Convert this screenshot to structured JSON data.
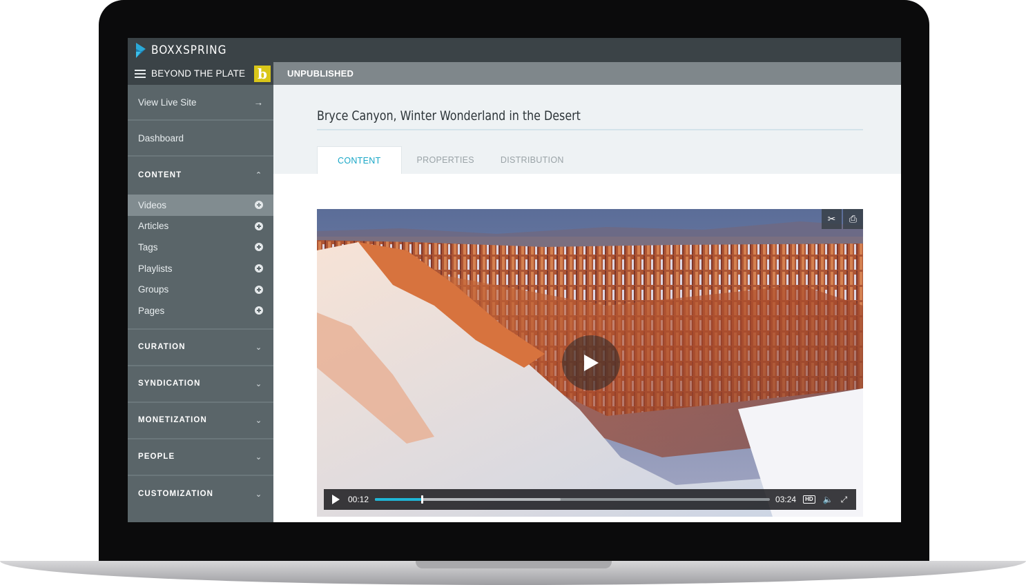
{
  "brand": {
    "name": "BOXXSPRING",
    "icon": "boxxspring-logo-icon",
    "logo_color": "#2aa9d8"
  },
  "site": {
    "name": "BEYOND THE PLATE",
    "badge_letter": "b",
    "badge_color": "#d9c619",
    "menu_icon": "hamburger-icon"
  },
  "nav": {
    "view_live_site": "View Live Site",
    "view_live_icon": "arrow-right-icon",
    "dashboard": "Dashboard"
  },
  "sidebar": {
    "content_section": {
      "label": "CONTENT",
      "expanded": true,
      "items": [
        {
          "label": "Videos",
          "active": true,
          "icon": "plus-circle-icon"
        },
        {
          "label": "Articles",
          "active": false,
          "icon": "plus-circle-icon"
        },
        {
          "label": "Tags",
          "active": false,
          "icon": "plus-circle-icon"
        },
        {
          "label": "Playlists",
          "active": false,
          "icon": "plus-circle-icon"
        },
        {
          "label": "Groups",
          "active": false,
          "icon": "plus-circle-icon"
        },
        {
          "label": "Pages",
          "active": false,
          "icon": "plus-circle-icon"
        }
      ]
    },
    "sections": [
      {
        "label": "CURATION",
        "expanded": false
      },
      {
        "label": "SYNDICATION",
        "expanded": false
      },
      {
        "label": "MONETIZATION",
        "expanded": false
      },
      {
        "label": "PEOPLE",
        "expanded": false
      },
      {
        "label": "CUSTOMIZATION",
        "expanded": false
      }
    ]
  },
  "main": {
    "status": "UNPUBLISHED",
    "title": "Bryce Canyon, Winter Wonderland in the Desert",
    "tabs": [
      {
        "label": "CONTENT",
        "active": true
      },
      {
        "label": "PROPERTIES",
        "active": false
      },
      {
        "label": "DISTRIBUTION",
        "active": false
      }
    ]
  },
  "video": {
    "current_time": "00:12",
    "total_time": "03:24",
    "progress": 0.118,
    "buffered": 0.47,
    "quality_label": "HD",
    "tool_icons": [
      "scissors-icon",
      "thumbnail-capture-icon"
    ],
    "control_icons": [
      "play-icon",
      "volume-icon",
      "fullscreen-icon"
    ],
    "accent": "#1fb6d6"
  },
  "colors": {
    "topbar": "#3b4347",
    "sidebar": "#5a6569",
    "sidebar_active": "#818c90",
    "status_bar": "#7f878b",
    "tab_active": "#19a7c7"
  }
}
